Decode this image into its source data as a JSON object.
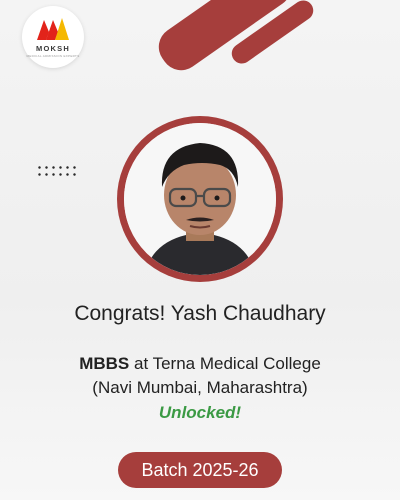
{
  "logo": {
    "name": "MOKSH",
    "tagline": "MEDICAL ADMISSION EXPERTS"
  },
  "student": {
    "greeting": "Congrats! Yash Chaudhary",
    "course": "MBBS",
    "connector": " at ",
    "college": "Terna Medical College",
    "location": "(Navi Mumbai, Maharashtra)",
    "status": "Unlocked!",
    "photo_icon": "student-portrait"
  },
  "batch": {
    "label": "Batch 2025-26"
  },
  "colors": {
    "accent": "#a63e3c",
    "success": "#3b9a44",
    "logo_red": "#e2231a",
    "logo_yellow": "#f5b800"
  }
}
